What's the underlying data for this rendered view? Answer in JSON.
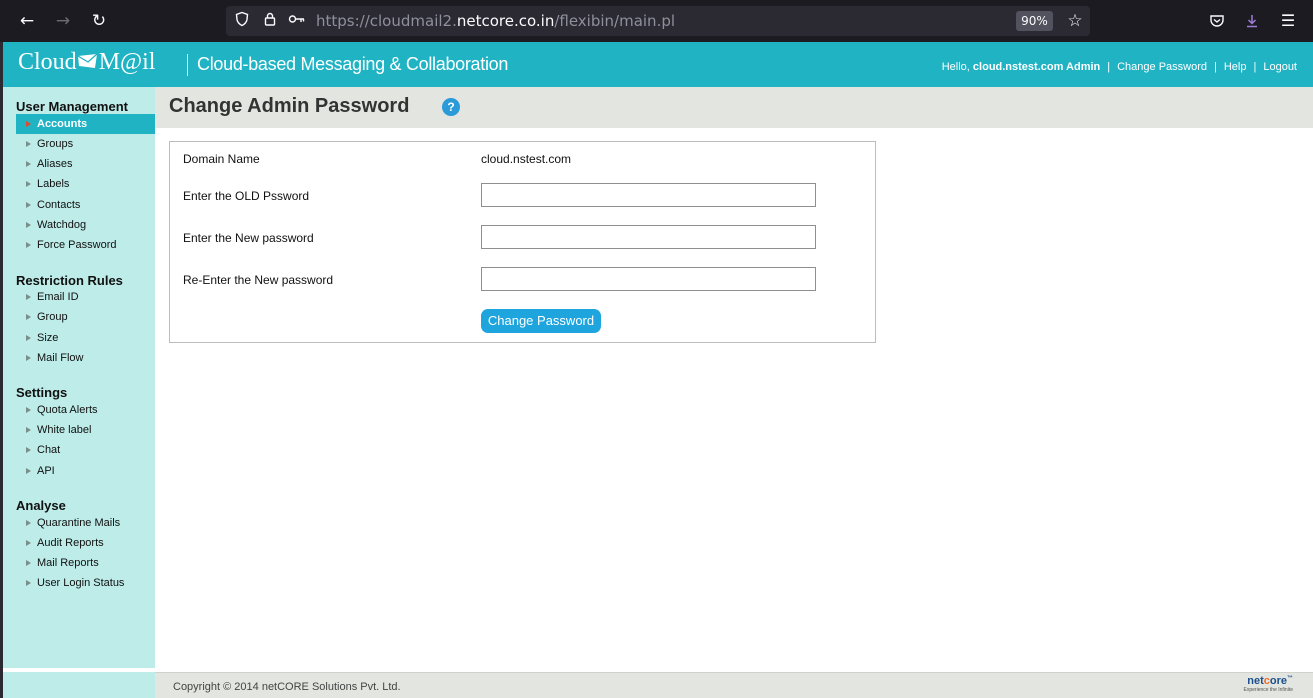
{
  "browser": {
    "back_icon": "←",
    "forward_icon": "→",
    "reload_icon": "↻",
    "shield_icon": "shield",
    "lock_icon": "lock",
    "key_icon": "key",
    "url_prefix": "https://cloudmail2.",
    "url_host": "netcore.co.in",
    "url_suffix": "/flexibin/main.pl",
    "zoom": "90%",
    "star_icon": "☆",
    "pocket_icon": "pocket",
    "download_icon": "download",
    "menu_icon": "☰"
  },
  "header": {
    "logo_text_1": "Cloud",
    "logo_text_2": "M@il",
    "tagline": "Cloud-based Messaging & Collaboration",
    "greeting": "Hello,",
    "user": "cloud.nstest.com Admin",
    "sep": "|",
    "link_change_password": "Change Password",
    "link_help": "Help",
    "link_logout": "Logout"
  },
  "sidebar": {
    "sections": [
      {
        "title": "User Management",
        "items": [
          "Accounts",
          "Groups",
          "Aliases",
          "Labels",
          "Contacts",
          "Watchdog",
          "Force Password"
        ]
      },
      {
        "title": "Restriction Rules",
        "items": [
          "Email ID",
          "Group",
          "Size",
          "Mail Flow"
        ]
      },
      {
        "title": "Settings",
        "items": [
          "Quota Alerts",
          "White label",
          "Chat",
          "API"
        ]
      },
      {
        "title": "Analyse",
        "items": [
          "Quarantine Mails",
          "Audit Reports",
          "Mail Reports",
          "User Login Status"
        ]
      }
    ],
    "active_item": "Accounts"
  },
  "main": {
    "title": "Change Admin Password",
    "help_icon_text": "?",
    "form": {
      "domain_label": "Domain Name",
      "domain_value": "cloud.nstest.com",
      "old_label": "Enter the OLD Pssword",
      "old_value": "",
      "new_label": "Enter the New password",
      "new_value": "",
      "reenter_label": "Re-Enter the New password",
      "reenter_value": "",
      "submit_label": "Change Password"
    }
  },
  "footer": {
    "copyright": "Copyright © 2014 netCORE Solutions Pvt. Ltd.",
    "logo_net": "net",
    "logo_core_o": "c",
    "logo_core_rest": "ore",
    "logo_tm": "™",
    "logo_tagline": "Experience the Infinite"
  },
  "colors": {
    "header_bg": "#1fb3c4",
    "sidebar_bg": "#bdece9",
    "active_bg": "#1fb3c4",
    "button_bg": "#1fa5dd",
    "title_band_bg": "#e3e6e0"
  }
}
